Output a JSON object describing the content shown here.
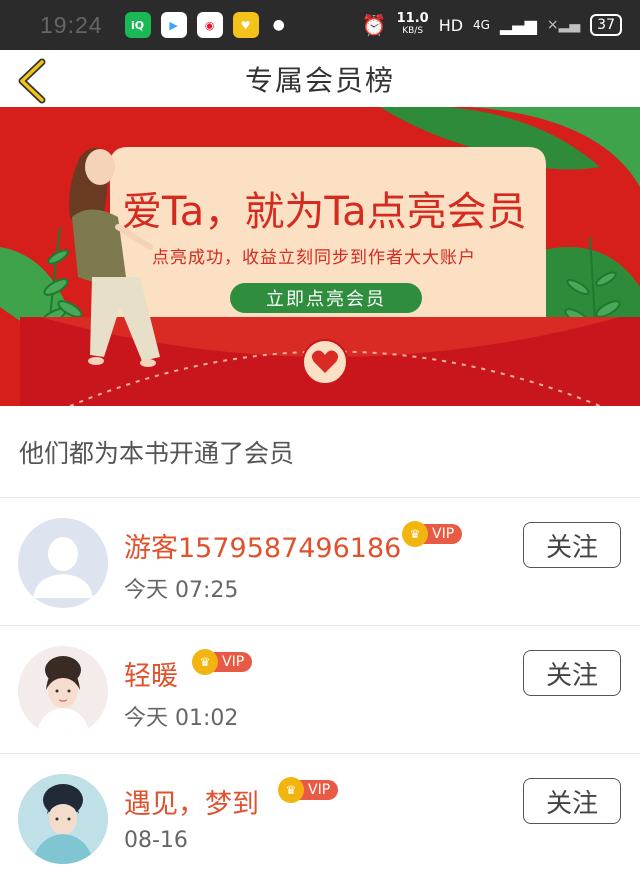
{
  "status_bar": {
    "time": "19:24",
    "net_speed": "11.0",
    "net_unit": "KB/S",
    "hd_label": "HD",
    "network_label": "4G",
    "battery": "37"
  },
  "header": {
    "title": "专属会员榜"
  },
  "banner": {
    "headline": "爱Ta，就为Ta点亮会员",
    "subtext": "点亮成功，收益立刻同步到作者大大账户",
    "cta_label": "立即点亮会员"
  },
  "section": {
    "title": "他们都为本书开通了会员"
  },
  "members": [
    {
      "name": "游客1579587496186",
      "time": "今天 07:25",
      "badge": "VIP",
      "follow_label": "关注"
    },
    {
      "name": "轻暖",
      "time": "今天 01:02",
      "badge": "VIP",
      "follow_label": "关注"
    },
    {
      "name": "遇见，梦到",
      "time": "08-16",
      "badge": "VIP",
      "follow_label": "关注"
    }
  ],
  "colors": {
    "accent": "#e0522e",
    "banner_red": "#d61f1a",
    "leaf_green": "#2e8b3a"
  }
}
